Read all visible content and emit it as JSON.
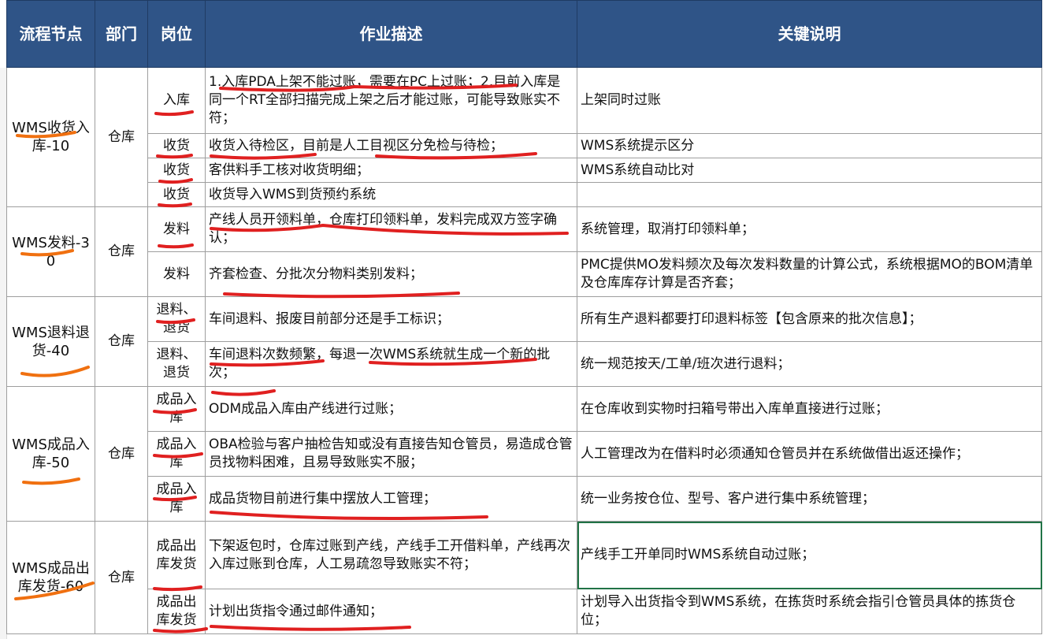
{
  "header": {
    "node": "流程节点",
    "dept": "部门",
    "post": "岗位",
    "desc": "作业描述",
    "key": "关键说明"
  },
  "groups": [
    {
      "node": "WMS收货入库-10",
      "dept": "仓库",
      "rows": [
        {
          "post": "入库",
          "desc": "1.入库PDA上架不能过账，需要在PC上过账；2.目前入库是同一个RT全部扫描完成上架之后才能过账，可能导致账实不符；",
          "key": "上架同时过账"
        },
        {
          "post": "收货",
          "desc": "收货入待检区，目前是人工目视区分免检与待检；",
          "key": "WMS系统提示区分"
        },
        {
          "post": "收货",
          "desc": "客供料手工核对收货明细；",
          "key": "WMS系统自动比对"
        },
        {
          "post": "收货",
          "desc": "收货导入WMS到货预约系统",
          "key": ""
        }
      ]
    },
    {
      "node": "WMS发料-30",
      "dept": "仓库",
      "rows": [
        {
          "post": "发料",
          "desc": "产线人员开领料单，仓库打印领料单，发料完成双方签字确认；",
          "key": "系统管理，取消打印领料单；"
        },
        {
          "post": "发料",
          "desc": "齐套检查、分批次分物料类别发料；",
          "key": "PMC提供MO发料频次及每次发料数量的计算公式，系统根据MO的BOM清单及仓库库存计算是否齐套；"
        }
      ]
    },
    {
      "node": "WMS退料退货-40",
      "dept": "仓库",
      "rows": [
        {
          "post": "退料、退货",
          "desc": "车间退料、报废目前部分还是手工标识；",
          "key": "所有生产退料都要打印退料标签【包含原来的批次信息】；"
        },
        {
          "post": "退料、退货",
          "desc": "车间退料次数频繁，每退一次WMS系统就生成一个新的批次；",
          "key": "统一规范按天/工单/班次进行退料；"
        }
      ]
    },
    {
      "node": "WMS成品入库-50",
      "dept": "仓库",
      "rows": [
        {
          "post": "成品入库",
          "desc": "ODM成品入库由产线进行过账；",
          "key": "在仓库收到实物时扫箱号带出入库单直接进行过账；"
        },
        {
          "post": "成品入库",
          "desc": "OBA检验与客户抽检告知或没有直接告知仓管员，易造成仓管员找物料困难，且易导致账实不服；",
          "key": "人工管理改为在借料时必须通知仓管员并在系统做借出返还操作；"
        },
        {
          "post": "成品入库",
          "desc": "成品货物目前进行集中摆放人工管理；",
          "key": "统一业务按仓位、型号、客户进行集中系统管理；"
        }
      ]
    },
    {
      "node": "WMS成品出库发货-60",
      "dept": "仓库",
      "rows": [
        {
          "post": "成品出库发货",
          "desc": "下架返包时，仓库过账到产线，产线手工开借料单，产线再次入库过账到仓库，人工易疏忽导致账实不符；",
          "key": "产线手工开单同时WMS系统自动过账；"
        },
        {
          "post": "成品出库发货",
          "desc": "计划出货指令通过邮件通知；",
          "key": "计划导入出货指令到WMS系统，在拣货时系统会指引仓管员具体的拣货仓位；"
        }
      ]
    }
  ],
  "annotation_color": "#e02020",
  "node_underline_color": "#f07010",
  "header_color": "#2f5487"
}
